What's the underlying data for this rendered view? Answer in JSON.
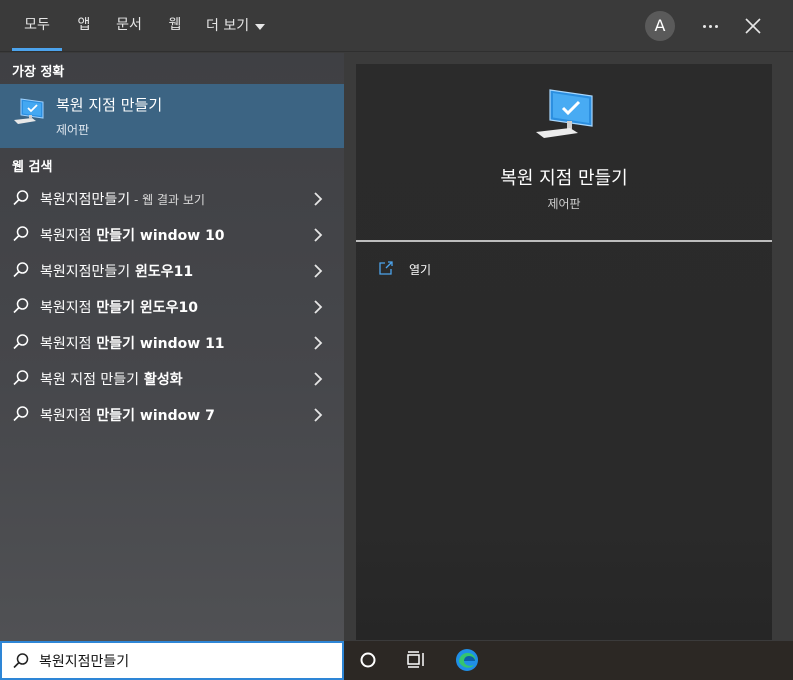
{
  "tabs": [
    {
      "label": "모두",
      "active": true
    },
    {
      "label": "앱"
    },
    {
      "label": "문서"
    },
    {
      "label": "웹"
    },
    {
      "label": "더 보기"
    }
  ],
  "header": {
    "avatar_letter": "A",
    "more_icon": "ellipsis-icon",
    "close_icon": "close-icon"
  },
  "best_match": {
    "section_label": "가장 정확",
    "title": "복원 지점 만들기",
    "subtitle": "제어판",
    "icon": "monitor-check-icon"
  },
  "web_search": {
    "section_label": "웹 검색",
    "items": [
      {
        "prefix": "복원지점만들기",
        "bold": "",
        "suffix": " - 웹 결과 보기"
      },
      {
        "prefix": "복원지점",
        "bold": " 만들기 window 10",
        "suffix": ""
      },
      {
        "prefix": "복원지점만들기",
        "bold": " 윈도우11",
        "suffix": ""
      },
      {
        "prefix": "복원지점",
        "bold": " 만들기 윈도우10",
        "suffix": ""
      },
      {
        "prefix": "복원지점",
        "bold": " 만들기 window 11",
        "suffix": ""
      },
      {
        "prefix": "복원 지점 만들기",
        "bold": " 활성화",
        "suffix": ""
      },
      {
        "prefix": "복원지점",
        "bold": " 만들기 window 7",
        "suffix": ""
      }
    ]
  },
  "detail": {
    "title": "복원 지점 만들기",
    "subtitle": "제어판",
    "actions": [
      {
        "label": "열기",
        "icon": "open-external-icon"
      }
    ]
  },
  "search": {
    "value": "복원지점만들기"
  },
  "taskbar": {
    "icons": [
      "cortana-circle-icon",
      "task-view-icon",
      "edge-icon"
    ]
  },
  "colors": {
    "accent": "#4ca3ec",
    "selected": "#3c6483",
    "search_border": "#2e86d6"
  }
}
